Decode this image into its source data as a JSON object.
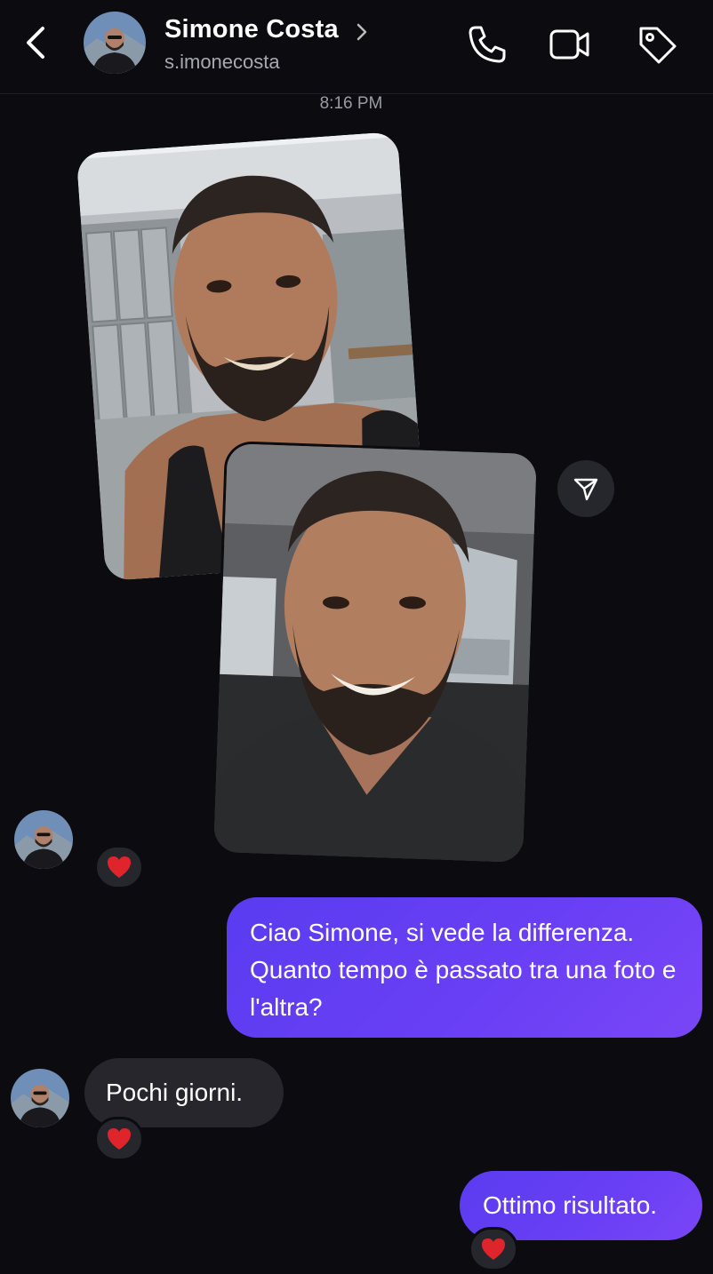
{
  "header": {
    "name": "Simone Costa",
    "username": "s.imonecosta",
    "icons": [
      "back-arrow",
      "chevron-right",
      "phone",
      "video-camera",
      "tag"
    ]
  },
  "thread": {
    "timestamp": "8:16 PM",
    "messages": [
      {
        "from": "contact",
        "type": "photo-pair",
        "description_icons": [
          "send-icon"
        ],
        "reaction": "❤️"
      },
      {
        "from": "me",
        "text": "Ciao Simone, si vede la differenza. Quanto tempo è passato tra una foto e l'altra?"
      },
      {
        "from": "contact",
        "text": "Pochi giorni.",
        "reaction": "❤️"
      },
      {
        "from": "me",
        "text": "Ottimo risultato.",
        "reaction": "❤️"
      }
    ]
  },
  "colors": {
    "background": "#0c0c10",
    "outgoing_bubble": "#6a3ff5",
    "incoming_bubble": "#26262c"
  }
}
